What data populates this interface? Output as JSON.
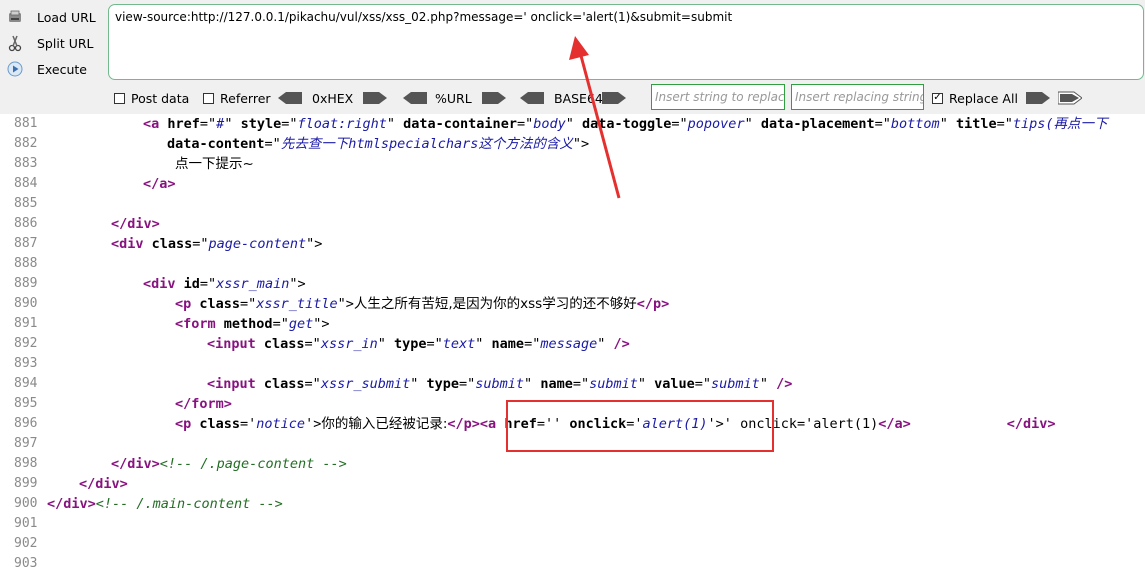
{
  "toolbar": {
    "load_url": "Load URL",
    "split_url": "Split URL",
    "execute": "Execute",
    "url_value": "view-source:http://127.0.0.1/pikachu/vul/xss/xss_02.php?message=' onclick='alert(1)&submit=submit",
    "post_data": "Post data",
    "referrer": "Referrer",
    "hex": "0xHEX",
    "pct_url": "%URL",
    "base64": "BASE64",
    "insert_placeholder": "Insert string to replace",
    "replace_placeholder": "Insert replacing string",
    "replace_all": "Replace All"
  },
  "source": {
    "line_numbers": [
      "881",
      "882",
      "883",
      "884",
      "885",
      "886",
      "887",
      "888",
      "889",
      "890",
      "891",
      "892",
      "893",
      "894",
      "895",
      "896",
      "897",
      "898",
      "899",
      "900",
      "901",
      "902",
      "903"
    ],
    "l881": {
      "t1": "<a ",
      "a1": "href",
      "eq1": "=\"",
      "v1": "#",
      "q1": "\" ",
      "a2": "style",
      "eq2": "=\"",
      "v2": "float:right",
      "q2": "\" ",
      "a3": "data-container",
      "eq3": "=\"",
      "v3": "body",
      "q3": "\" ",
      "a4": "data-toggle",
      "eq4": "=\"",
      "v4": "popover",
      "q4": "\" ",
      "a5": "data-placement",
      "eq5": "=\"",
      "v5": "bottom",
      "q5": "\" ",
      "a6": "title",
      "eq6": "=\"",
      "v6": "tips(再点一下"
    },
    "l882": {
      "a1": "data-content",
      "eq1": "=\"",
      "v1": "先去查一下htmlspecialchars这个方法的含义",
      "q1": "\">"
    },
    "l883": {
      "text": "点一下提示~"
    },
    "l884": {
      "t1": "</a>"
    },
    "l886": {
      "t1": "</div>"
    },
    "l887": {
      "t1": "<div ",
      "a1": "class",
      "eq1": "=\"",
      "v1": "page-content",
      "q1": "\">"
    },
    "l889": {
      "t1": "<div ",
      "a1": "id",
      "eq1": "=\"",
      "v1": "xssr_main",
      "q1": "\">"
    },
    "l890": {
      "t1": "<p ",
      "a1": "class",
      "eq1": "=\"",
      "v1": "xssr_title",
      "q1": "\">",
      "text": "人生之所有苦短,是因为你的xss学习的还不够好",
      "t2": "</p>"
    },
    "l891": {
      "t1": "<form ",
      "a1": "method",
      "eq1": "=\"",
      "v1": "get",
      "q1": "\">"
    },
    "l892": {
      "t1": "<input ",
      "a1": "class",
      "eq1": "=\"",
      "v1": "xssr_in",
      "q1": "\" ",
      "a2": "type",
      "eq2": "=\"",
      "v2": "text",
      "q2": "\" ",
      "a3": "name",
      "eq3": "=\"",
      "v3": "message",
      "q3": "\" ",
      "t2": "/>"
    },
    "l894": {
      "t1": "<input ",
      "a1": "class",
      "eq1": "=\"",
      "v1": "xssr_submit",
      "q1": "\" ",
      "a2": "type",
      "eq2": "=\"",
      "v2": "submit",
      "q2": "\" ",
      "a3": "name",
      "eq3": "=\"",
      "v3": "submit",
      "q3": "\" ",
      "a4": "value",
      "eq4": "=\"",
      "v4": "submit",
      "q4": "\" ",
      "t2": "/>"
    },
    "l895": {
      "t1": "</form>"
    },
    "l896": {
      "t1": "<p ",
      "a1": "class",
      "eq1": "='",
      "v1": "notice",
      "q1": "'>",
      "text": "你的输入已经被记录:",
      "t2": "</p>",
      "t3": "<a ",
      "a2": "href",
      "eq2": "=''",
      "a3": " onclick",
      "eq3": "='",
      "v3": "alert(1)",
      "q3": "'>'",
      "text2": " onclick='alert(1)",
      "t4": "</a>",
      "t5": "</div>"
    },
    "l898": {
      "t1": "</div>",
      "c1": "<!-- /.page-content -->"
    },
    "l899": {
      "t1": "</div>"
    },
    "l900": {
      "t1": "</div>",
      "c1": "<!-- /.main-content -->"
    }
  },
  "colors": {
    "tag": "#881280",
    "attr_value": "#1a1aa6",
    "comment": "#236e25",
    "highlight": "#e53030",
    "url_border": "#72b98d"
  }
}
